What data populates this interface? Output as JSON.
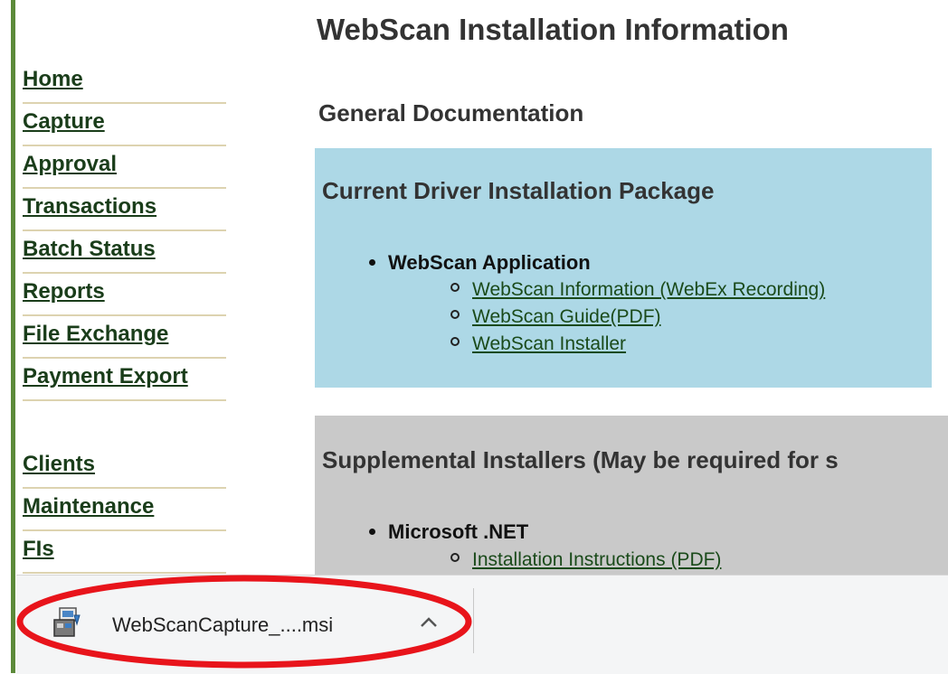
{
  "page": {
    "title": "WebScan Installation Information"
  },
  "sidebar": {
    "items": [
      {
        "label": "Home"
      },
      {
        "label": "Capture"
      },
      {
        "label": "Approval"
      },
      {
        "label": "Transactions"
      },
      {
        "label": "Batch Status"
      },
      {
        "label": "Reports"
      },
      {
        "label": "File Exchange"
      },
      {
        "label": "Payment Export"
      },
      {
        "label": "Clients"
      },
      {
        "label": "Maintenance"
      },
      {
        "label": "FIs"
      }
    ]
  },
  "main": {
    "section_heading": "General Documentation",
    "current_package": {
      "title": "Current Driver Installation Package",
      "group": "WebScan Application",
      "links": [
        {
          "label": "WebScan Information (WebEx Recording)"
        },
        {
          "label": "WebScan Guide(PDF)"
        },
        {
          "label": "WebScan Installer"
        }
      ]
    },
    "supplemental": {
      "title": "Supplemental Installers (May be required for s",
      "group": "Microsoft .NET",
      "links": [
        {
          "label": "Installation Instructions (PDF)"
        }
      ]
    }
  },
  "download_bar": {
    "file_name": "WebScanCapture_....msi",
    "file_icon": "msi-installer-icon",
    "toggle_icon": "chevron-up-icon"
  },
  "colors": {
    "sidebar_text": "#1a3d1a",
    "panel_blue": "#add8e6",
    "panel_gray": "#c9c9c9",
    "annotation_ring": "#e8141b",
    "frame_line": "#5c8a3a"
  }
}
